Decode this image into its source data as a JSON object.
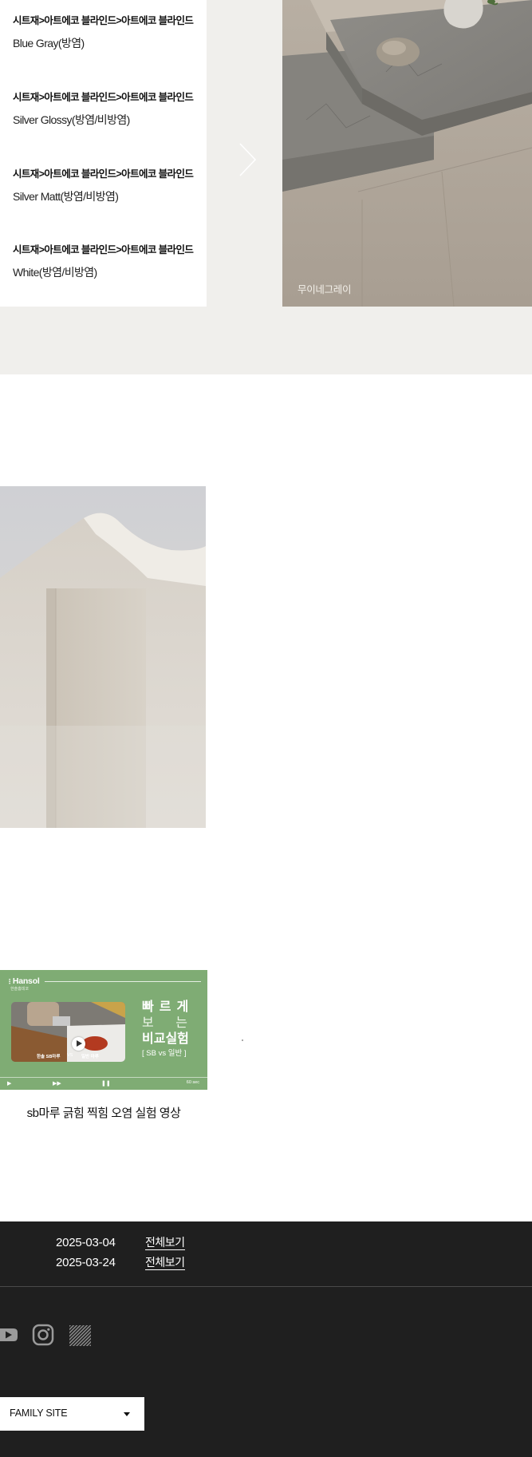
{
  "products": [
    {
      "category": "시트재>아트에코 블라인드>아트에코 블라인드",
      "name": "Blue Gray(방염)"
    },
    {
      "category": "시트재>아트에코 블라인드>아트에코 블라인드",
      "name": "Silver Glossy(방염/비방염)"
    },
    {
      "category": "시트재>아트에코 블라인드>아트에코 블라인드",
      "name": "Silver Matt(방염/비방염)"
    },
    {
      "category": "시트재>아트에코 블라인드>아트에코 블라인드",
      "name": "White(방염/비방염)"
    }
  ],
  "hero": {
    "caption": "무이네그레이"
  },
  "video": {
    "brand": "Hansol",
    "brand_sub": "한솔홈데코",
    "title_line1": "빠르게",
    "title_line2a": "보",
    "title_line2b": "는",
    "title_line3": "비교실험",
    "title_line4": "[ SB vs 일반 ]",
    "label_left": "한솔 SB마루",
    "label_vs": "VS",
    "label_right": "일반 마루",
    "duration": "60 sec",
    "caption": "sb마루 긁힘 찍힘 오염 실험 영상"
  },
  "footer": {
    "notices": [
      {
        "date": "2025-03-04",
        "link": "전체보기"
      },
      {
        "date": "2025-03-24",
        "link": "전체보기"
      }
    ],
    "family_site": "FAMILY SITE"
  },
  "colors": {
    "section_bg": "#f0efec",
    "video_green": "#7fac74",
    "footer_bg": "#1f1f1f"
  }
}
